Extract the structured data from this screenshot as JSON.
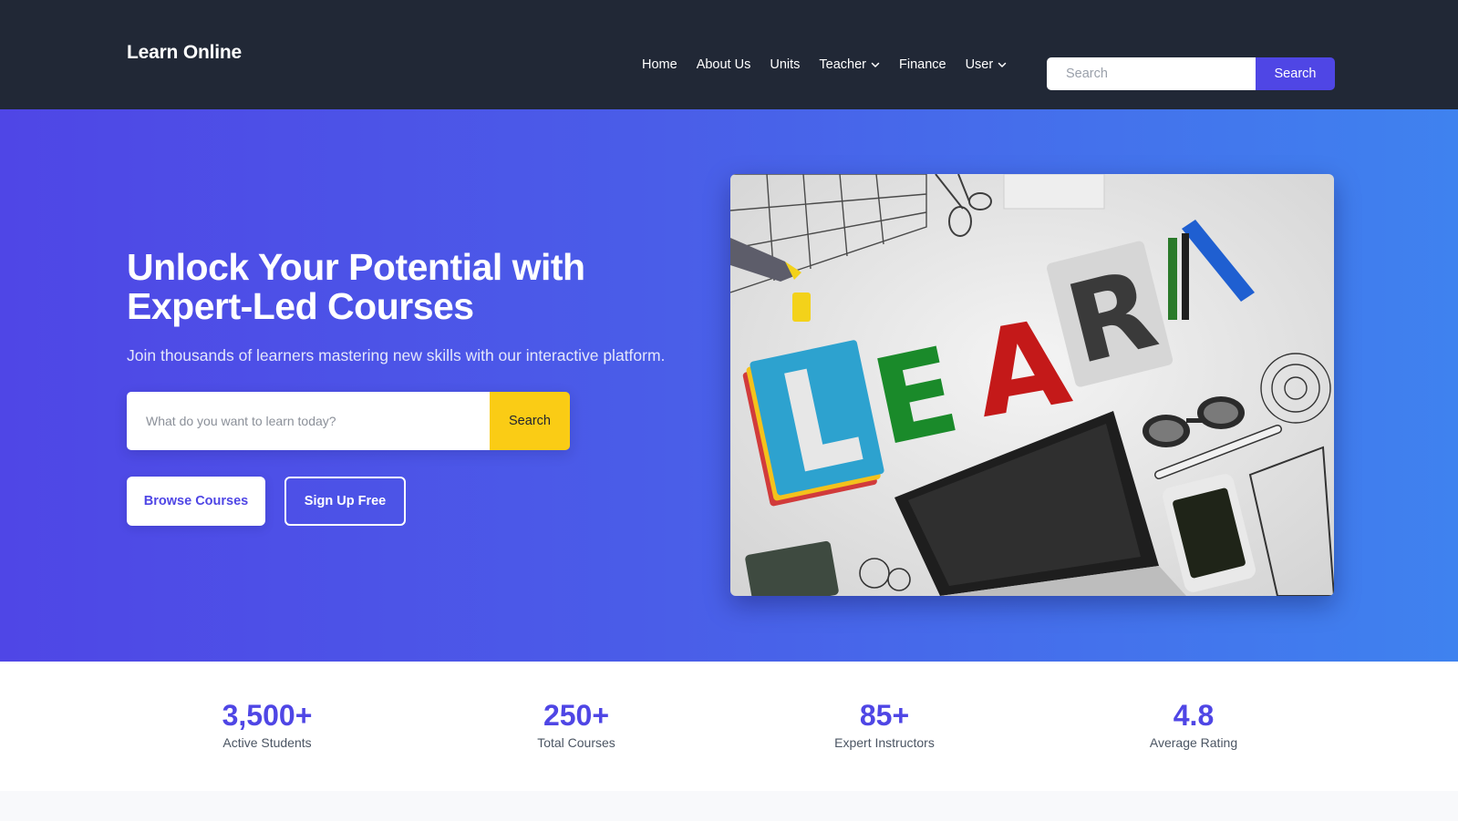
{
  "navbar": {
    "brand": "Learn Online",
    "links": [
      {
        "label": "Home",
        "dropdown": false
      },
      {
        "label": "About Us",
        "dropdown": false
      },
      {
        "label": "Units",
        "dropdown": false
      },
      {
        "label": "Teacher",
        "dropdown": true
      },
      {
        "label": "Finance",
        "dropdown": false
      },
      {
        "label": "User",
        "dropdown": true
      }
    ],
    "search": {
      "placeholder": "Search",
      "button_label": "Search"
    }
  },
  "hero": {
    "title": "Unlock Your Potential with Expert-Led Courses",
    "subtitle": "Join thousands of learners mastering new skills with our interactive platform.",
    "search": {
      "placeholder": "What do you want to learn today?",
      "button_label": "Search"
    },
    "browse_button": "Browse Courses",
    "signup_button": "Sign Up Free",
    "image_letters": [
      "L",
      "E",
      "A",
      "R",
      "N"
    ]
  },
  "stats": [
    {
      "value": "3,500+",
      "label": "Active Students"
    },
    {
      "value": "250+",
      "label": "Total Courses"
    },
    {
      "value": "85+",
      "label": "Expert Instructors"
    },
    {
      "value": "4.8",
      "label": "Average Rating"
    }
  ],
  "colors": {
    "navbar_bg": "#212836",
    "accent": "#4f46e5",
    "cta_yellow": "#facc15",
    "hero_gradient_start": "#4f46e6",
    "hero_gradient_end": "#3f82ef"
  }
}
